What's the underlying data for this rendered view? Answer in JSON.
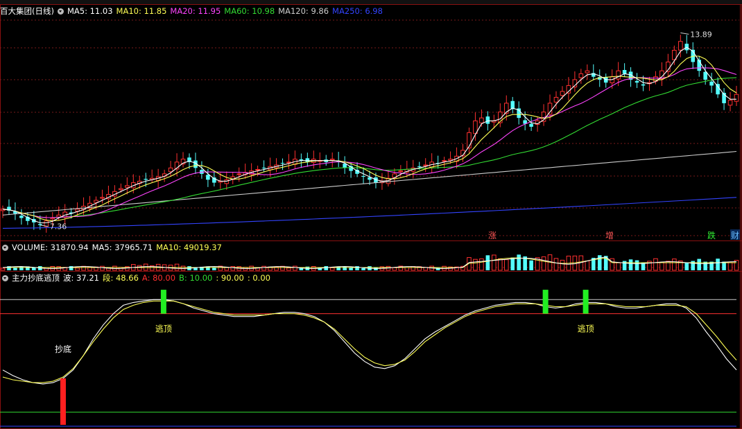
{
  "colors": {
    "up": "#ff3030",
    "down": "#54ffff",
    "ma5": "#ffffff",
    "ma10": "#ffff55",
    "ma20": "#ff44ff",
    "ma60": "#33dd33",
    "ma120": "#cccccc",
    "ma250": "#3344ff",
    "grid": "#7a1a1a",
    "border": "#8a1010"
  },
  "price_panel": {
    "title": "百大集团(日线)",
    "ma_items": [
      {
        "key": "ma5",
        "label": "MA5: 11.03"
      },
      {
        "key": "ma10",
        "label": "MA10: 11.85"
      },
      {
        "key": "ma20",
        "label": "MA20: 11.95"
      },
      {
        "key": "ma60",
        "label": "MA60: 10.98"
      },
      {
        "key": "ma120",
        "label": "MA120: 9.86"
      },
      {
        "key": "ma250",
        "label": "MA250: 6.98"
      }
    ],
    "high_label": "13.89",
    "low_label": "7.36",
    "markers": [
      {
        "text": "涨",
        "type": "up"
      },
      {
        "text": "增",
        "type": "up"
      },
      {
        "text": "跌",
        "type": "down"
      },
      {
        "text": "财",
        "type": "info"
      }
    ]
  },
  "volume_panel": {
    "items": [
      {
        "key": "white",
        "label": "VOLUME: 31870.94"
      },
      {
        "key": "white",
        "label": "MA5: 37965.71"
      },
      {
        "key": "ma10",
        "label": "MA10: 49019.37"
      }
    ]
  },
  "indicator_panel": {
    "items": [
      {
        "key": "white",
        "label": "主力抄底逃顶"
      },
      {
        "key": "white",
        "label": "波: 37.21"
      },
      {
        "key": "ma10",
        "label": "段: 48.66"
      },
      {
        "key": "up",
        "label": "A: 80.00"
      },
      {
        "key": "ma60",
        "label": "B: 10.00"
      },
      {
        "key": "ma10",
        "label": ": 90.00"
      },
      {
        "key": "ma10",
        "label": ": 0.00"
      }
    ],
    "signal_labels": {
      "bottom": "抄底",
      "top": "逃顶"
    }
  },
  "chart_data": [
    {
      "type": "candlestick",
      "title": "百大集团(日线)",
      "low": 7.36,
      "high": 13.89,
      "ylim": [
        7.0,
        14.3
      ],
      "series_summary": [
        {
          "name": "MA5",
          "last": 11.03
        },
        {
          "name": "MA10",
          "last": 11.85
        },
        {
          "name": "MA20",
          "last": 11.95
        },
        {
          "name": "MA60",
          "last": 10.98
        },
        {
          "name": "MA120",
          "last": 9.86
        },
        {
          "name": "MA250",
          "last": 6.98
        }
      ],
      "closes": [
        7.9,
        7.85,
        7.75,
        7.6,
        7.5,
        7.45,
        7.36,
        7.5,
        7.6,
        7.7,
        7.8,
        7.75,
        7.9,
        8.0,
        8.1,
        8.2,
        8.3,
        8.4,
        8.5,
        8.6,
        8.7,
        8.8,
        8.85,
        8.9,
        8.95,
        9.0,
        9.1,
        9.3,
        9.5,
        9.6,
        9.5,
        9.3,
        9.1,
        8.9,
        8.8,
        8.85,
        8.9,
        9.0,
        9.1,
        9.15,
        9.2,
        9.25,
        9.3,
        9.35,
        9.4,
        9.45,
        9.5,
        9.6,
        9.55,
        9.5,
        9.6,
        9.55,
        9.5,
        9.6,
        9.5,
        9.3,
        9.2,
        9.1,
        9.0,
        8.9,
        8.8,
        8.85,
        8.95,
        9.1,
        9.2,
        9.25,
        9.3,
        9.35,
        9.4,
        9.5,
        9.45,
        9.55,
        9.6,
        9.7,
        9.9,
        10.5,
        10.9,
        11.0,
        10.8,
        10.9,
        11.2,
        11.5,
        11.3,
        11.0,
        10.8,
        10.7,
        10.9,
        11.2,
        11.5,
        11.7,
        11.9,
        12.1,
        12.3,
        12.5,
        12.6,
        12.4,
        12.3,
        12.2,
        12.4,
        12.6,
        12.5,
        12.3,
        12.2,
        12.1,
        12.2,
        12.4,
        12.6,
        12.9,
        13.3,
        13.6,
        13.3,
        12.9,
        12.6,
        12.3,
        12.1,
        11.8,
        11.5,
        11.6,
        11.8
      ],
      "ma5_last": 11.03
    },
    {
      "type": "bar",
      "title": "VOLUME",
      "values_summary": {
        "VOLUME": 31870.94,
        "MA5": 37965.71,
        "MA10": 49019.37
      }
    },
    {
      "type": "line",
      "title": "主力抄底逃顶",
      "ylim": [
        0,
        100
      ],
      "levels": [
        {
          "name": "A",
          "value": 80
        },
        {
          "name": "B",
          "value": 10
        },
        {
          "value": 90
        },
        {
          "value": 0
        }
      ],
      "series": [
        {
          "name": "波",
          "key": "ma5",
          "values": [
            40,
            36,
            33,
            31,
            30,
            31,
            34,
            40,
            50,
            62,
            72,
            80,
            86,
            88,
            89,
            90,
            90,
            89,
            87,
            84,
            82,
            80,
            79,
            78,
            78,
            78,
            79,
            80,
            81,
            81,
            80,
            78,
            74,
            68,
            60,
            52,
            46,
            42,
            41,
            43,
            48,
            55,
            62,
            67,
            71,
            75,
            79,
            82,
            84,
            86,
            87,
            88,
            88,
            87,
            85,
            84,
            85,
            87,
            88,
            88,
            87,
            85,
            84,
            84,
            85,
            86,
            87,
            87,
            84,
            77,
            67,
            58,
            48,
            40
          ]
        },
        {
          "name": "段",
          "key": "ma10",
          "values": [
            35,
            33,
            32,
            31,
            31,
            32,
            35,
            41,
            50,
            60,
            69,
            77,
            83,
            86,
            88,
            89,
            89,
            89,
            87,
            85,
            83,
            81,
            80,
            79,
            79,
            79,
            79,
            80,
            80,
            80,
            79,
            77,
            74,
            69,
            62,
            55,
            49,
            45,
            43,
            44,
            47,
            53,
            60,
            65,
            70,
            74,
            78,
            81,
            83,
            85,
            86,
            87,
            87,
            87,
            86,
            85,
            85,
            86,
            87,
            87,
            87,
            86,
            85,
            85,
            85,
            86,
            86,
            86,
            85,
            80,
            72,
            64,
            55,
            47
          ]
        }
      ],
      "signals": [
        {
          "type": "bottom",
          "label": "抄底",
          "index": 6
        },
        {
          "type": "top",
          "label": "逃顶",
          "index": 16
        },
        {
          "type": "top",
          "label": "逃顶",
          "index": 54
        },
        {
          "type": "top",
          "label": "逃顶",
          "index": 58
        }
      ]
    }
  ]
}
